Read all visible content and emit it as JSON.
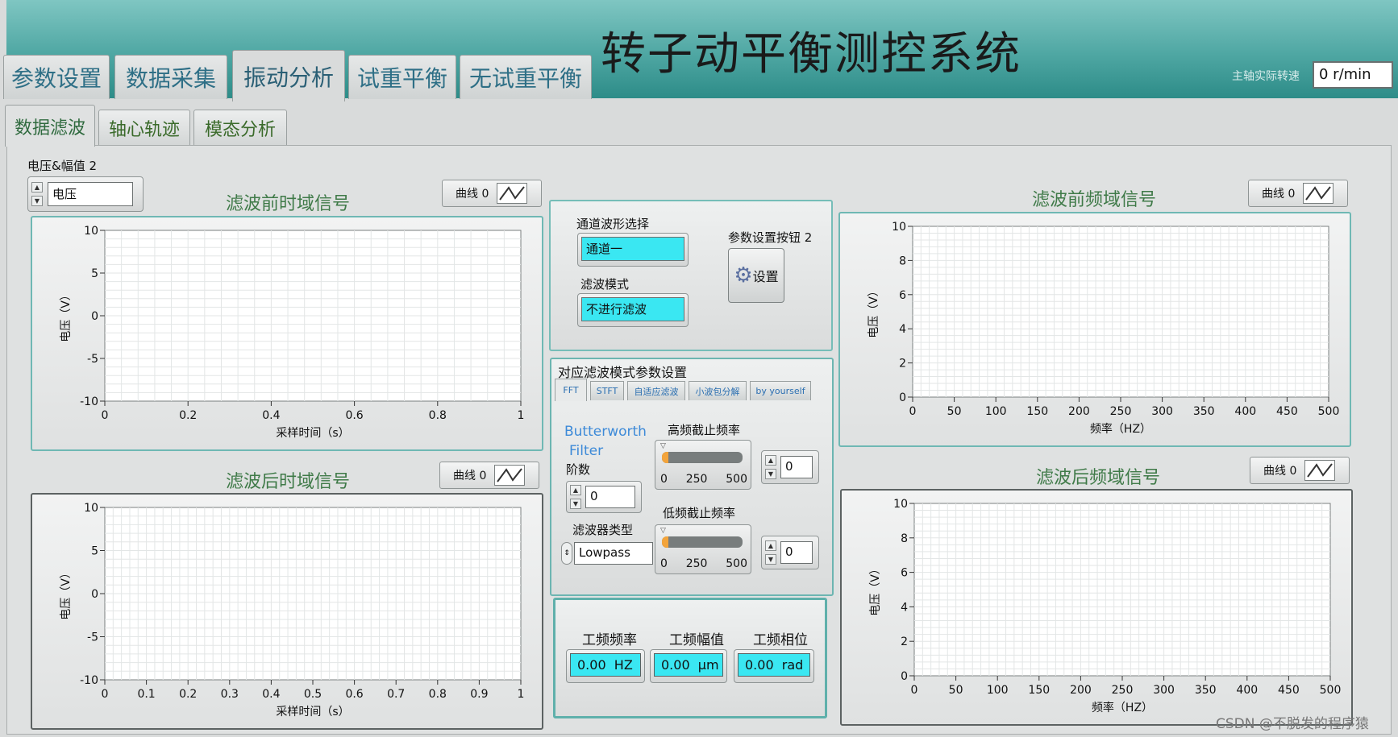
{
  "app": {
    "title": "转子动平衡测控系统"
  },
  "main_tabs": [
    {
      "label": "参数设置"
    },
    {
      "label": "数据采集"
    },
    {
      "label": "振动分析",
      "active": true
    },
    {
      "label": "试重平衡"
    },
    {
      "label": "无试重平衡"
    }
  ],
  "speed": {
    "label": "主轴实际转速",
    "value": "0 r/min"
  },
  "sub_tabs": [
    {
      "label": "数据滤波",
      "active": true
    },
    {
      "label": "轴心轨迹"
    },
    {
      "label": "模态分析"
    }
  ],
  "selector": {
    "label": "电压&幅值 2",
    "value": "电压"
  },
  "legend_label": "曲线 0",
  "charts": {
    "pre_time": {
      "title": "滤波前时域信号",
      "xlabel": "采样时间（s）",
      "ylabel": "电压（V）",
      "xticks": [
        "0",
        "0.2",
        "0.4",
        "0.6",
        "0.8",
        "1"
      ],
      "yticks": [
        "10",
        "5",
        "0",
        "-5",
        "-10"
      ]
    },
    "post_time": {
      "title": "滤波后时域信号",
      "xlabel": "采样时间（s）",
      "ylabel": "电压（V）",
      "xticks": [
        "0",
        "0.1",
        "0.2",
        "0.3",
        "0.4",
        "0.5",
        "0.6",
        "0.7",
        "0.8",
        "0.9",
        "1"
      ],
      "yticks": [
        "10",
        "5",
        "0",
        "-5",
        "-10"
      ]
    },
    "pre_freq": {
      "title": "滤波前频域信号",
      "xlabel": "频率（HZ）",
      "ylabel": "电压（V）",
      "xticks": [
        "0",
        "50",
        "100",
        "150",
        "200",
        "250",
        "300",
        "350",
        "400",
        "450",
        "500"
      ],
      "yticks": [
        "10",
        "8",
        "6",
        "4",
        "2",
        "0"
      ]
    },
    "post_freq": {
      "title": "滤波后频域信号",
      "xlabel": "频率（HZ）",
      "ylabel": "电压（V）",
      "xticks": [
        "0",
        "50",
        "100",
        "150",
        "200",
        "250",
        "300",
        "350",
        "400",
        "450",
        "500"
      ],
      "yticks": [
        "10",
        "8",
        "6",
        "4",
        "2",
        "0"
      ]
    }
  },
  "channel": {
    "label": "通道波形选择",
    "value": "通道一"
  },
  "filter_mode": {
    "label": "滤波模式",
    "value": "不进行滤波"
  },
  "param_button": {
    "label": "参数设置按钮 2",
    "text": "设置"
  },
  "filter_params": {
    "title": "对应滤波模式参数设置",
    "tabs": [
      {
        "label": "FFT",
        "active": true
      },
      {
        "label": "STFT"
      },
      {
        "label": "自适应滤波"
      },
      {
        "label": "小波包分解"
      },
      {
        "label": "by yourself"
      }
    ],
    "filter_name_line1": "Butterworth",
    "filter_name_line2": "Filter",
    "order_label": "阶数",
    "order_value": "0",
    "type_label": "滤波器类型",
    "type_value": "Lowpass",
    "high_cutoff": {
      "label": "高频截止频率",
      "ticks": [
        "0",
        "250",
        "500"
      ],
      "value": "0",
      "fraction": 0
    },
    "low_cutoff": {
      "label": "低频截止频率",
      "ticks": [
        "0",
        "250",
        "500"
      ],
      "value": "0",
      "fraction": 0
    }
  },
  "power_freq": {
    "freq": {
      "label": "工频频率",
      "value": "0.00",
      "unit": "HZ"
    },
    "amp": {
      "label": "工频幅值",
      "value": "0.00",
      "unit": "μm"
    },
    "phase": {
      "label": "工频相位",
      "value": "0.00",
      "unit": "rad"
    }
  },
  "watermark": "CSDN @不脱发的程序猿"
}
